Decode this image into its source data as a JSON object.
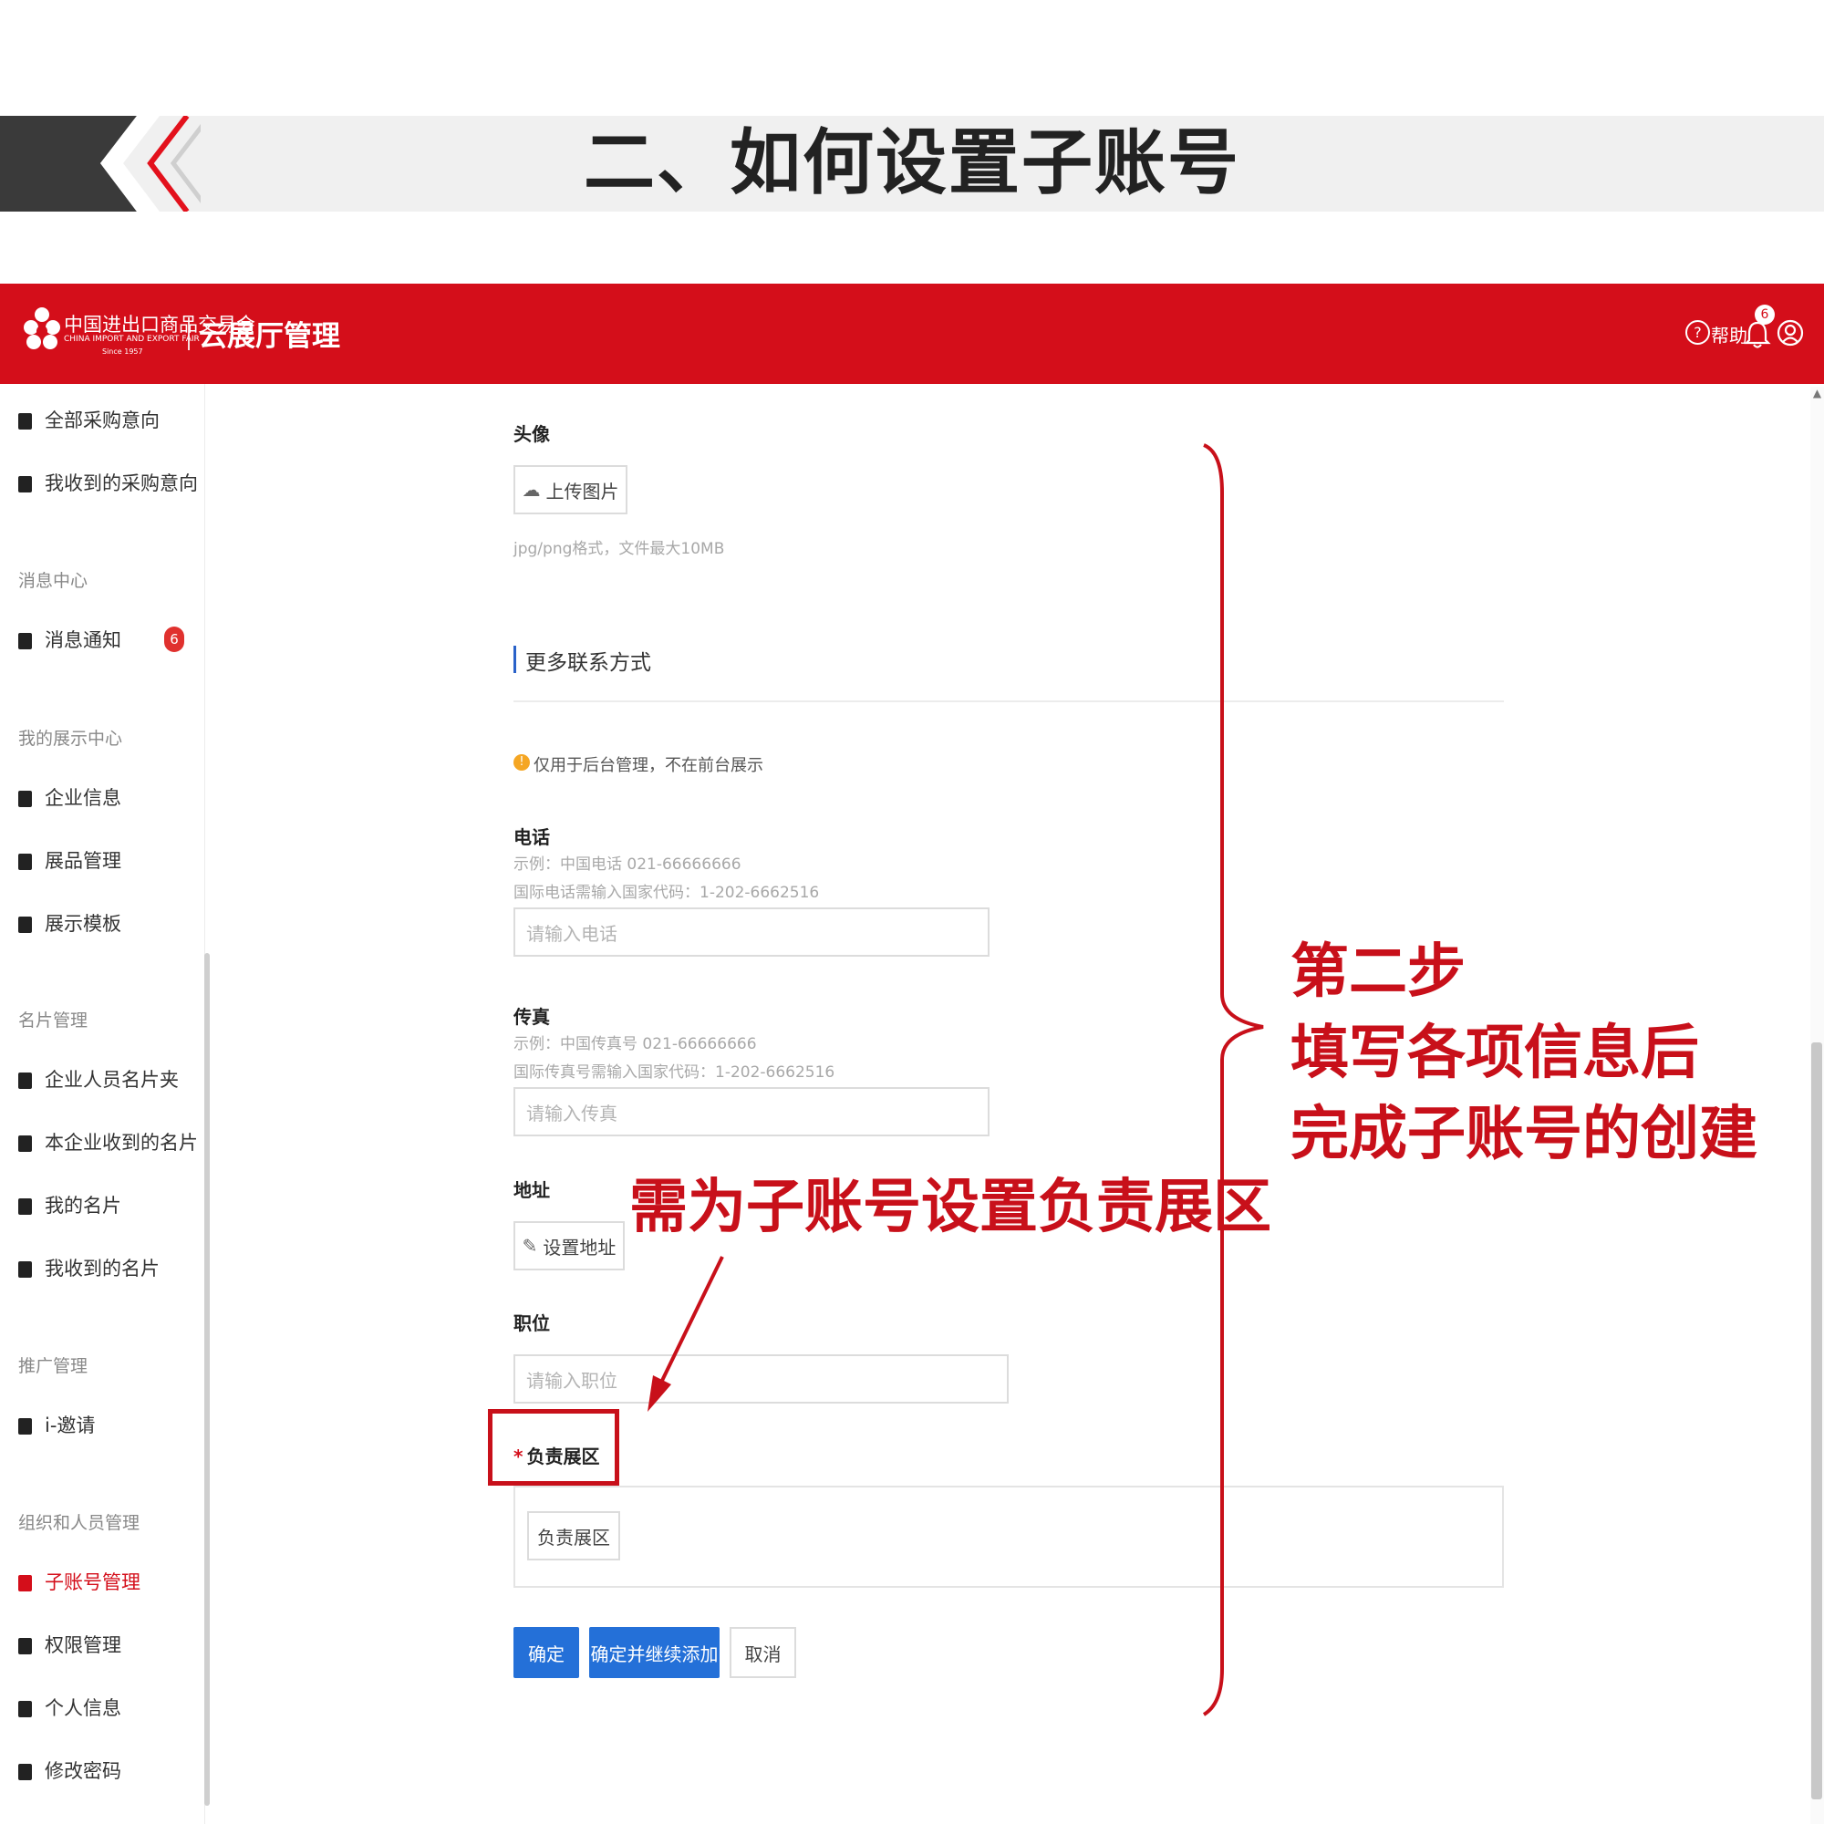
{
  "slide": {
    "title": "二、如何设置子账号"
  },
  "header": {
    "logo_cn": "中国进出口商品交易会",
    "logo_en": "CHINA IMPORT AND EXPORT FAIR",
    "logo_since": "Since 1957",
    "app_name": "云展厅管理",
    "help_label": "帮助",
    "bell_badge": "6",
    "brand_color": "#d40e1a"
  },
  "sidebar": {
    "items": [
      {
        "label": "全部采购意向",
        "icon": "list-icon"
      },
      {
        "label": "我收到的采购意向",
        "icon": "inbox-icon"
      },
      {
        "group": "消息中心"
      },
      {
        "label": "消息通知",
        "icon": "bell-icon",
        "badge": "6"
      },
      {
        "group": "我的展示中心"
      },
      {
        "label": "企业信息",
        "icon": "org-icon"
      },
      {
        "label": "展品管理",
        "icon": "grid-icon"
      },
      {
        "label": "展示模板",
        "icon": "brush-icon"
      },
      {
        "group": "名片管理"
      },
      {
        "label": "企业人员名片夹",
        "icon": "card-folder-icon"
      },
      {
        "label": "本企业收到的名片",
        "icon": "card-icon"
      },
      {
        "label": "我的名片",
        "icon": "card-icon"
      },
      {
        "label": "我收到的名片",
        "icon": "card-icon"
      },
      {
        "group": "推广管理"
      },
      {
        "label": "i-邀请",
        "icon": "invite-icon"
      },
      {
        "group": "组织和人员管理"
      },
      {
        "label": "子账号管理",
        "icon": "id-card-icon",
        "active": true
      },
      {
        "label": "权限管理",
        "icon": "lock-icon"
      },
      {
        "label": "个人信息",
        "icon": "profile-icon"
      },
      {
        "label": "修改密码",
        "icon": "key-icon"
      }
    ]
  },
  "form": {
    "avatar_label": "头像",
    "upload_button": "上传图片",
    "upload_hint": "jpg/png格式，文件最大10MB",
    "section_title": "更多联系方式",
    "notice": "仅用于后台管理，不在前台展示",
    "phone_label": "电话",
    "phone_hint1": "示例：中国电话 021-66666666",
    "phone_hint2": "国际电话需输入国家代码：1-202-6662516",
    "phone_placeholder": "请输入电话",
    "fax_label": "传真",
    "fax_hint1": "示例：中国传真号 021-66666666",
    "fax_hint2": "国际传真号需输入国家代码：1-202-6662516",
    "fax_placeholder": "请输入传真",
    "address_label": "地址",
    "address_button": "设置地址",
    "position_label": "职位",
    "position_placeholder": "请输入职位",
    "zone_label": "负责展区",
    "zone_required": "*",
    "zone_button": "负责展区",
    "confirm": "确定",
    "confirm_continue": "确定并继续添加",
    "cancel": "取消",
    "primary_color": "#2470d8"
  },
  "annotations": {
    "zone_note": "需为子账号设置负责展区",
    "step_title": "第二步",
    "step_line1": "填写各项信息后",
    "step_line2": "完成子账号的创建",
    "color": "#c8101a"
  }
}
